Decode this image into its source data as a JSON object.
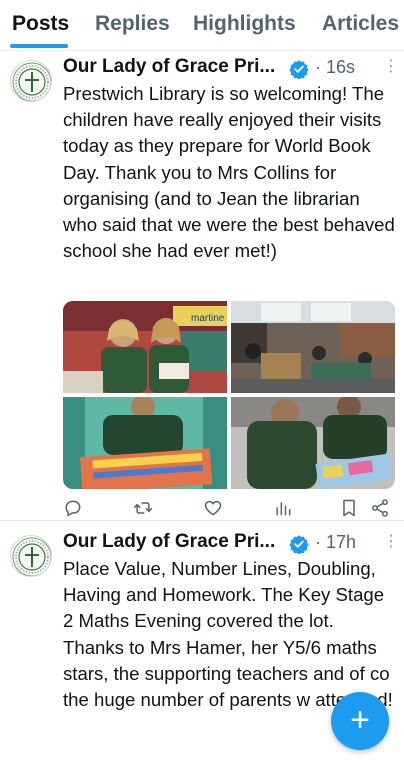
{
  "tabs": [
    {
      "label": "Posts",
      "active": true
    },
    {
      "label": "Replies",
      "active": false
    },
    {
      "label": "Highlights",
      "active": false
    },
    {
      "label": "Articles",
      "active": false
    }
  ],
  "posts": [
    {
      "author": "Our Lady of Grace Pri...",
      "time": "16s",
      "text": "Prestwich Library is so welcoming! The children have really enjoyed their visits today as they prepare for World Book Day. Thank you to Mrs Collins for organising (and to Jean the librarian who said that we were the best behaved school she had ever met!)",
      "media_icons": [
        "library-photo-icon",
        "library-photo-icon",
        "library-photo-icon",
        "library-photo-icon"
      ],
      "media_label": "martine",
      "actions": [
        "reply-icon",
        "repost-icon",
        "like-icon",
        "views-icon",
        "bookmark-icon",
        "share-icon"
      ]
    },
    {
      "author": "Our Lady of Grace Pri...",
      "time": "17h",
      "text": "Place Value, Number Lines, Doubling, Having and Homework. The Key Stage 2 Maths Evening covered the lot. Thanks to Mrs Hamer, her Y5/6 maths stars, the supporting teachers and of co the huge number of parents w attended!"
    }
  ],
  "compose_button": {
    "icon": "plus-icon",
    "label": "+"
  },
  "colors": {
    "accent": "#1d9bf0",
    "text": "#0f1419",
    "muted": "#536471",
    "divider": "#e7e9ea"
  }
}
